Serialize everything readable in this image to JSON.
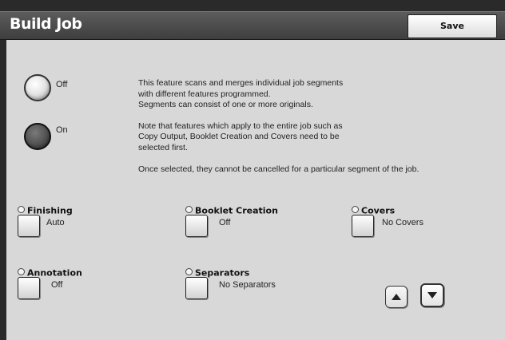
{
  "header": {
    "title": "Build Job",
    "save_label": "Save"
  },
  "mode": {
    "off_label": "Off",
    "on_label": "On",
    "selected": "On"
  },
  "description": {
    "line1": "This feature scans and merges individual job segments",
    "line2": "with different features programmed.",
    "line3": "Segments can consist of one or more originals.",
    "line4": "Note that features which apply to the entire job such as",
    "line5": "Copy Output, Booklet Creation and Covers need to be",
    "line6": "selected first.",
    "line7": "Once selected, they cannot be cancelled for a particular segment of the job."
  },
  "features": {
    "finishing": {
      "title": "Finishing",
      "value": "Auto"
    },
    "booklet": {
      "title": "Booklet Creation",
      "value": "Off"
    },
    "covers": {
      "title": "Covers",
      "value": "No Covers"
    },
    "annotation": {
      "title": "Annotation",
      "value": "Off"
    },
    "separators": {
      "title": "Separators",
      "value": "No Separators"
    }
  },
  "icons": {
    "scroll_up": "triangle-up-icon",
    "scroll_down": "triangle-down-icon"
  }
}
